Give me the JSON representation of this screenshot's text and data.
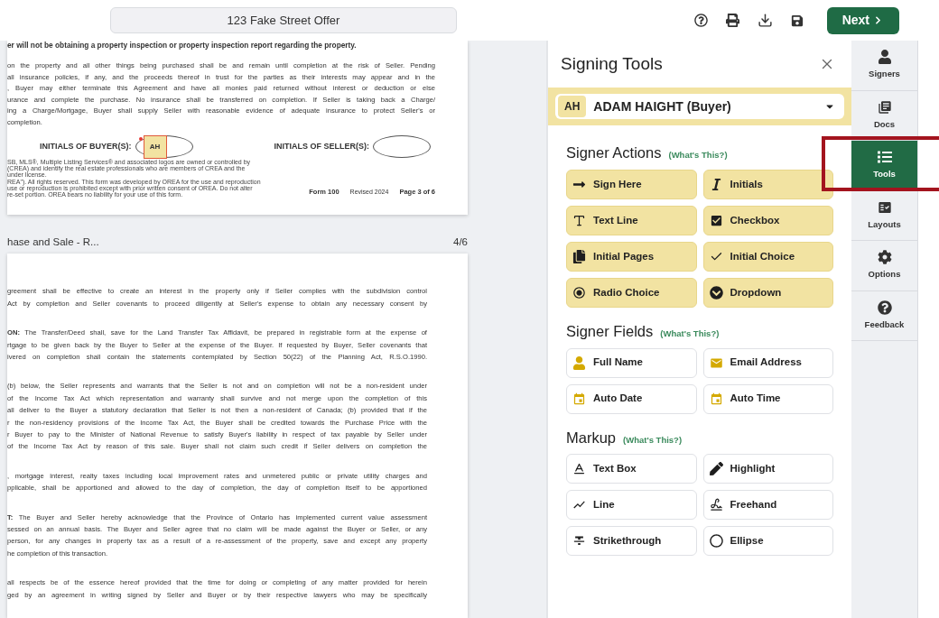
{
  "toolbar": {
    "title": "123 Fake Street Offer",
    "next_button": "Next"
  },
  "document": {
    "upper_page": {
      "heading": "er will not be obtaining a property inspection or property inspection report regarding the property.",
      "paragraphs": [
        {
          "lines": [
            "on the property and all other things being purchased shall be and remain until completion at the risk of Seller. Pending",
            "all insurance policies, if any, and the proceeds thereof in trust for the parties as their interests may appear and in the",
            ", Buyer may either terminate this Agreement and have all monies paid returned without interest or deduction or else",
            "urance and complete the purchase. No insurance shall be transferred on completion. If Seller is taking back a Charge/",
            "ing a Charge/Mortgage, Buyer shall supply Seller with reasonable evidence of adequate insurance to protect Seller's or",
            "completion."
          ]
        }
      ],
      "initials": [
        {
          "label": "INITIALS OF BUYER(S):",
          "value": "AH"
        },
        {
          "label": "INITIALS OF SELLER(S):"
        }
      ],
      "fine_print": [
        "SB, MLS®, Multiple Listing Services® and associated logos are owned or controlled by",
        "(CREA) and identify the real estate professionals who are members of CREA and the",
        "under license.",
        "REA\"). All rights reserved. This form was developed by OREA for the use and reproduction",
        "use or reproduction is prohibited except with prior written consent of OREA. Do not alter",
        "re-set portion. OREA bears no liability for your use of this form."
      ],
      "footer": {
        "form": "Form 100",
        "revised": "Revised 2024",
        "page": "Page 3 of 6"
      }
    },
    "doc_title": "hase and Sale - R...",
    "page_counter": "4/6",
    "lower_page": {
      "paragraphs": [
        {
          "ends": false,
          "lines": [
            "greement shall be effective to create an interest in the property only if Seller complies with the subdivision control",
            "Act by completion and Seller covenants to proceed diligently at Seller's expense to obtain any necessary consent by"
          ]
        },
        {
          "ends": false,
          "lines": [
            "**ON:** The Transfer/Deed shall, save for the Land Transfer Tax Affidavit, be prepared in registrable form at the expense of",
            "rtgage to be given back by the Buyer to Seller at the expense of the Buyer. If requested by Buyer, Seller covenants that",
            "ivered on completion shall contain the statements contemplated by Section 50(22) of the Planning Act, R.S.O.1990."
          ]
        },
        {
          "ends": false,
          "lines": [
            "(b) below, the Seller represents and warrants that the Seller is not and on completion will not be a non-resident under",
            "of the Income Tax Act which representation and warranty shall survive and not merge upon the completion of this",
            "all deliver to the Buyer a statutory declaration that Seller is not then a non-resident of Canada; (b) provided that if the",
            "r the non-residency provisions of the Income Tax Act, the Buyer shall be credited towards the Purchase Price with the",
            "r Buyer to pay to the Minister of National Revenue to satisfy Buyer's liability in respect of tax payable by Seller under",
            "of the Income Tax Act by reason of this sale. Buyer shall not claim such credit if Seller delivers on completion the"
          ]
        },
        {
          "ends": false,
          "lines": [
            ", mortgage interest, realty taxes including local improvement rates and unmetered public or private utility charges and",
            "pplicable, shall be apportioned and allowed to the day of completion, the day of completion itself to be apportioned"
          ]
        },
        {
          "ends": true,
          "lines": [
            "**T:** The Buyer and Seller hereby acknowledge that the Province of Ontario has implemented current value assessment",
            "sessed on an annual basis. The Buyer and Seller agree that no claim will be made against the Buyer or Seller, or any",
            "person, for any changes in property tax as a result of a re-assessment of the property, save and except any property",
            "he completion of this transaction."
          ]
        },
        {
          "ends": false,
          "lines": [
            "all respects be of the essence hereof provided that the time for doing or completing of any matter provided for herein",
            "ged by an agreement in writing signed by Seller and Buyer or by their respective lawyers who may be specifically"
          ]
        }
      ]
    }
  },
  "panel": {
    "title": "Signing Tools",
    "signer": {
      "initials": "AH",
      "name": "ADAM HAIGHT (Buyer)"
    },
    "sections": [
      {
        "title": "Signer Actions",
        "help": "(What's This?)",
        "kind": "filled",
        "tools": [
          "Sign Here",
          "Initials",
          "Text Line",
          "Checkbox",
          "Initial Pages",
          "Initial Choice",
          "Radio Choice",
          "Dropdown"
        ]
      },
      {
        "title": "Signer Fields",
        "help": "(What's This?)",
        "kind": "outlined",
        "tools": [
          "Full Name",
          "Email Address",
          "Auto Date",
          "Auto Time"
        ]
      },
      {
        "title": "Markup",
        "help": "(What's This?)",
        "kind": "outlined",
        "tools": [
          "Text Box",
          "Highlight",
          "Line",
          "Freehand",
          "Strikethrough",
          "Ellipse"
        ]
      }
    ]
  },
  "nav": [
    {
      "label": "Signers",
      "selected": false,
      "outlined": false
    },
    {
      "label": "Docs",
      "selected": false,
      "outlined": false
    },
    {
      "label": "Tools",
      "selected": true,
      "outlined": true
    },
    {
      "label": "Layouts",
      "selected": false,
      "outlined": false
    },
    {
      "label": "Options",
      "selected": false,
      "outlined": false
    },
    {
      "label": "Feedback",
      "selected": false,
      "outlined": false
    }
  ]
}
